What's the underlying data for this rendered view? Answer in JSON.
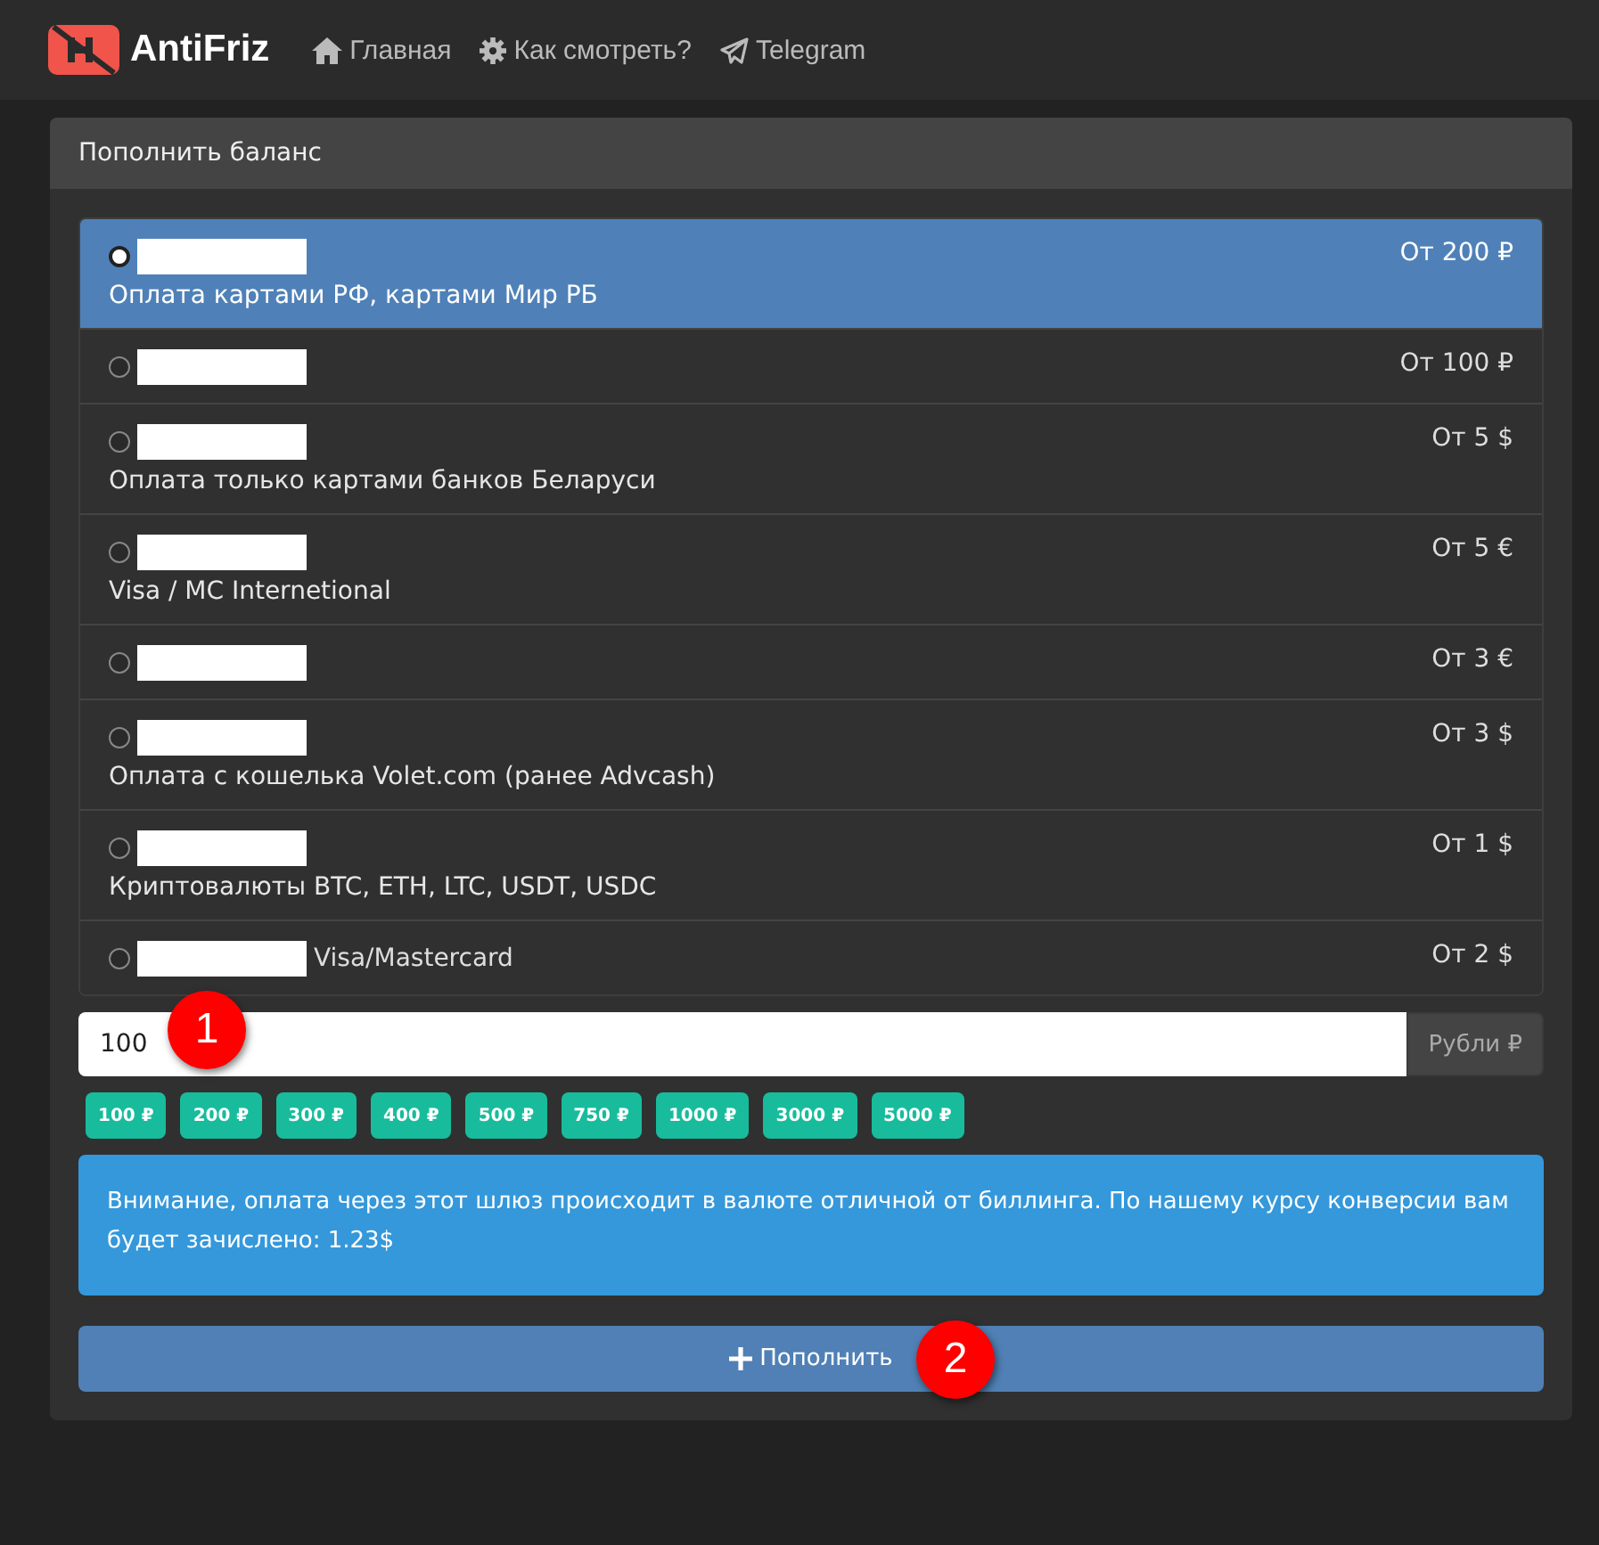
{
  "navbar": {
    "brand": "AntiFriz",
    "links": [
      {
        "kind": "home",
        "label": "Главная"
      },
      {
        "kind": "gear",
        "label": "Как смотреть?"
      },
      {
        "kind": "plane",
        "label": "Telegram"
      }
    ]
  },
  "panel": {
    "title": "Пополнить баланс"
  },
  "methods": [
    {
      "name_redacted": true,
      "description": "Оплата картами РФ, картами Мир РБ",
      "min": "От 200 ₽",
      "selected": true
    },
    {
      "name_redacted": true,
      "min": "От 100 ₽",
      "selected": false
    },
    {
      "name_redacted": true,
      "description": "Оплата только картами банков Беларуси",
      "min": "От 5 $",
      "selected": false
    },
    {
      "name_redacted": true,
      "description": "Visa / MC Internetional",
      "min": "От 5 €",
      "selected": false
    },
    {
      "name_redacted": true,
      "min": "От 3 €",
      "selected": false
    },
    {
      "name_redacted": true,
      "description": "Оплата с кошелька Volet.com (ранее Advcash)",
      "min": "От 3 $",
      "selected": false
    },
    {
      "name_redacted": true,
      "description": "Криптовалюты BTC, ETH, LTC, USDT, USDC",
      "min": "От 1 $",
      "selected": false
    },
    {
      "name_redacted": true,
      "name": "Visa/Mastercard",
      "min": "От 2 $",
      "selected": false
    }
  ],
  "amount": {
    "value": "100",
    "addon": "Рубли ₽"
  },
  "presets": [
    "100 ₽",
    "200 ₽",
    "300 ₽",
    "400 ₽",
    "500 ₽",
    "750 ₽",
    "1000 ₽",
    "3000 ₽",
    "5000 ₽"
  ],
  "alert": "Внимание, оплата через этот шлюз происходит в валюте отличной от биллинга. По нашему курсу конверсии вам будет зачислено: 1.23$",
  "submit": {
    "label": "Пополнить"
  },
  "markers": [
    "1",
    "2"
  ]
}
